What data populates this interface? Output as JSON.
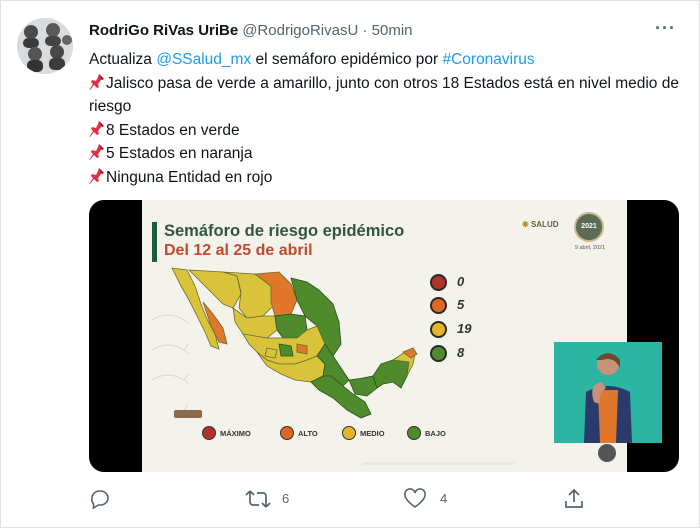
{
  "author": {
    "display_name": "RodriGo RiVas UriBe",
    "handle": "@RodrigoRivasU",
    "separator": " · ",
    "time": "50min"
  },
  "tweet": {
    "line1_prefix": "Actualiza ",
    "line1_mention": "@SSalud_mx",
    "line1_middle": " el semáforo epidémico por ",
    "line1_hashtag": "#Coronavirus",
    "line2": "Jalisco pasa de verde a amarillo, junto con otros 18 Estados está en nivel medio de riesgo",
    "line3": "8 Estados en verde",
    "line4": "5 Estados en naranja",
    "line5": "Ninguna Entidad en rojo"
  },
  "media": {
    "title": "Semáforo de riesgo epidémico",
    "subtitle": "Del 12 al 25 de abril",
    "logo_text": "SALUD",
    "seal_text": "2021",
    "date_text": "9 abril, 2021",
    "legend": [
      {
        "value": "0",
        "color": "#b3322a"
      },
      {
        "value": "5",
        "color": "#e0671f"
      },
      {
        "value": "19",
        "color": "#e6b52a"
      },
      {
        "value": "8",
        "color": "#4f8a2c"
      }
    ],
    "levels": [
      {
        "label": "MÁXIMO",
        "color": "#b3322a"
      },
      {
        "label": "ALTO",
        "color": "#e0671f"
      },
      {
        "label": "MEDIO",
        "color": "#e6b52a"
      },
      {
        "label": "BAJO",
        "color": "#4f8a2c"
      }
    ]
  },
  "actions": {
    "retweets": "6",
    "likes": "4"
  },
  "colors": {
    "link": "#1d9bf0",
    "muted": "#536471",
    "text": "#0f1419"
  },
  "icons": [
    "more-icon",
    "pushpin-icon",
    "reply-icon",
    "retweet-icon",
    "like-icon",
    "share-icon"
  ]
}
